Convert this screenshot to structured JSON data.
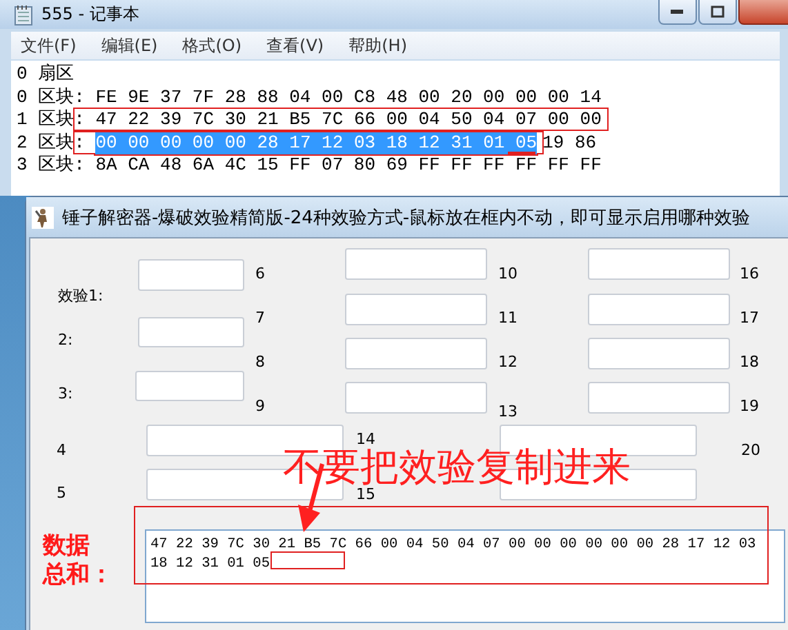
{
  "notepad": {
    "title": "555 - 记事本",
    "menu": [
      "文件(F)",
      "编辑(E)",
      "格式(O)",
      "查看(V)",
      "帮助(H)"
    ],
    "lines": [
      {
        "segments": [
          {
            "text": "0 扇区",
            "selected": false
          }
        ]
      },
      {
        "segments": [
          {
            "text": "0 区块: FE 9E 37 7F 28 88 04 00 C8 48 00 20 00 00 00 14",
            "selected": false
          }
        ]
      },
      {
        "segments": [
          {
            "text": "1 区块",
            "selected": false,
            "boxed": false
          },
          {
            "text": ": 47 22 39 7C 30 21 B5 7C 66 00 04 50 04 07 00 00",
            "selected": false,
            "boxed": true
          }
        ]
      },
      {
        "segments": [
          {
            "text": "2 区块",
            "selected": false,
            "boxed": false
          },
          {
            "text": ": ",
            "selected": false,
            "boxed": true
          },
          {
            "text": "00 00 00 00 00 28 17 12 03 18 12 31 01 05",
            "selected": true,
            "boxed": true
          },
          {
            "text": "19 86",
            "selected": false,
            "boxed": false
          }
        ]
      },
      {
        "segments": [
          {
            "text": "3 区块: 8A CA 48 6A 4C 15 FF 07 80 69 FF FF FF FF FF FF",
            "selected": false
          }
        ]
      }
    ]
  },
  "dialog": {
    "title": "锤子解密器-爆破效验精简版-24种效验方式-鼠标放在框内不动，即可显示启用哪种效验",
    "labels": [
      "效验1:",
      "2:",
      "3:",
      "4",
      "5",
      "6",
      "7",
      "8",
      "9",
      "10",
      "11",
      "12",
      "13",
      "14",
      "15",
      "16",
      "17",
      "18",
      "19",
      "20"
    ],
    "data_sum": {
      "label_lines": [
        "数据",
        "总和："
      ],
      "value": "47 22 39 7C 30 21 B5 7C 66 00 04 50 04 07 00 00 00 00 00 00 28 17 12 03 18 12 31 01 05"
    }
  },
  "annotation": {
    "note": "不要把效验复制进来"
  }
}
